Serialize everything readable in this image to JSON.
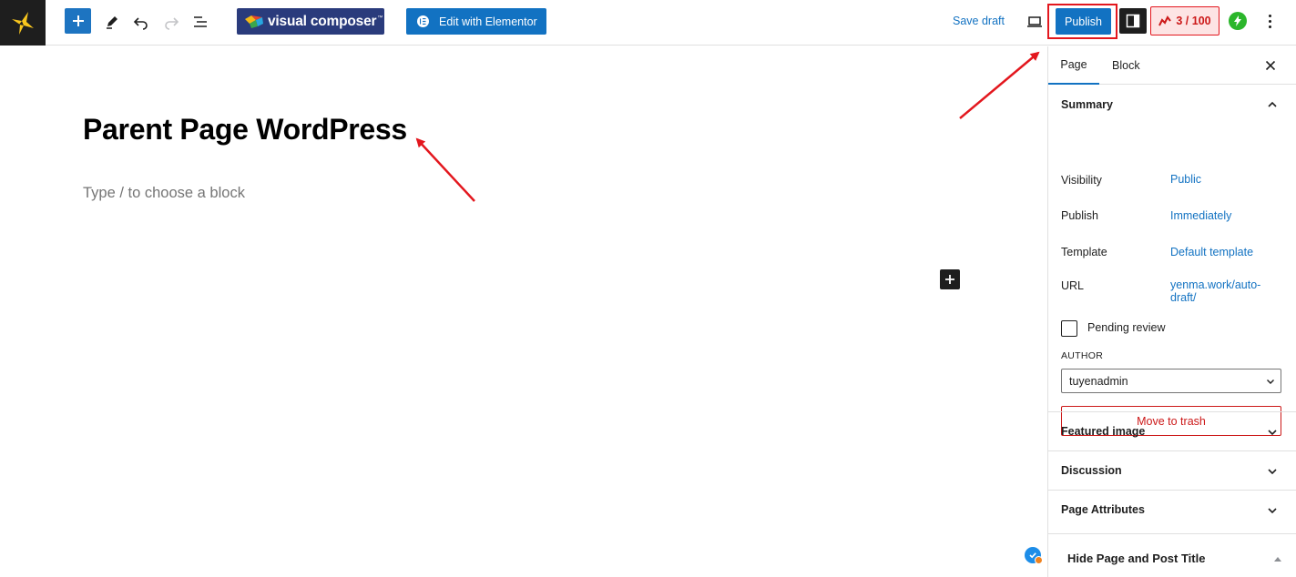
{
  "toolbar": {
    "visual_composer_label": "visual composer",
    "visual_composer_tm": "™",
    "elementor_label": "Edit with Elementor",
    "save_draft_label": "Save draft",
    "publish_label": "Publish",
    "score_label": "3 / 100"
  },
  "editor": {
    "title": "Parent Page WordPress",
    "block_placeholder": "Type / to choose a block"
  },
  "sidebar": {
    "tabs": [
      "Page",
      "Block"
    ],
    "summary": {
      "heading": "Summary",
      "rows": [
        {
          "label": "Visibility",
          "value": "Public"
        },
        {
          "label": "Publish",
          "value": "Immediately"
        },
        {
          "label": "Template",
          "value": "Default template"
        },
        {
          "label": "URL",
          "value": "yenma.work/auto-draft/"
        }
      ],
      "pending_review": "Pending review",
      "author_label": "AUTHOR",
      "author_value": "tuyenadmin",
      "trash_label": "Move to trash"
    },
    "sections": [
      "Featured image",
      "Discussion",
      "Page Attributes"
    ],
    "hide_title_panel": "Hide Page and Post Title"
  },
  "colors": {
    "accent": "#1272c2",
    "annotation": "#e3171e",
    "danger": "#cc1818"
  }
}
